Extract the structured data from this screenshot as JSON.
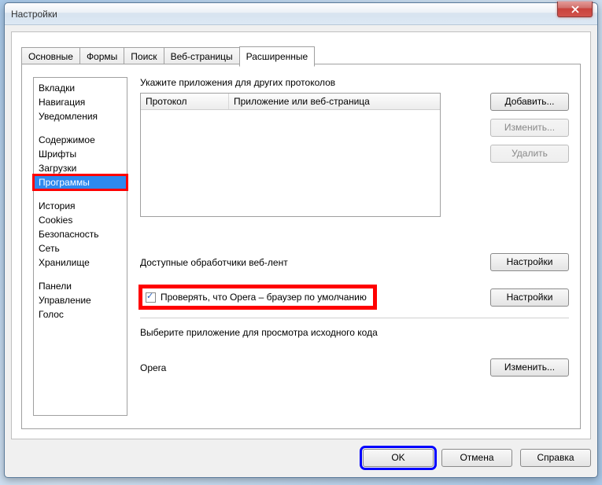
{
  "window": {
    "title": "Настройки"
  },
  "tabs": {
    "main": "Основные",
    "forms": "Формы",
    "search": "Поиск",
    "webpages": "Веб-страницы",
    "advanced": "Расширенные"
  },
  "sidebar": {
    "g1": {
      "tabs": "Вкладки",
      "nav": "Навигация",
      "notif": "Уведомления"
    },
    "g2": {
      "content": "Содержимое",
      "fonts": "Шрифты",
      "downloads": "Загрузки",
      "programs": "Программы"
    },
    "g3": {
      "history": "История",
      "cookies": "Cookies",
      "security": "Безопасность",
      "network": "Сеть",
      "storage": "Хранилище"
    },
    "g4": {
      "panels": "Панели",
      "management": "Управление",
      "voice": "Голос"
    }
  },
  "content": {
    "protocols_label": "Укажите приложения для других протоколов",
    "proto_columns": {
      "protocol": "Протокол",
      "app": "Приложение или веб-страница"
    },
    "btn_add": "Добавить...",
    "btn_edit": "Изменить...",
    "btn_delete": "Удалить",
    "feed_label": "Доступные обработчики веб-лент",
    "btn_settings": "Настройки",
    "default_check": "Проверять, что Opera – браузер по умолчанию",
    "viewer_label": "Выберите приложение для просмотра исходного кода",
    "viewer_app": "Opera",
    "btn_change": "Изменить..."
  },
  "footer": {
    "ok": "OK",
    "cancel": "Отмена",
    "help": "Справка"
  }
}
